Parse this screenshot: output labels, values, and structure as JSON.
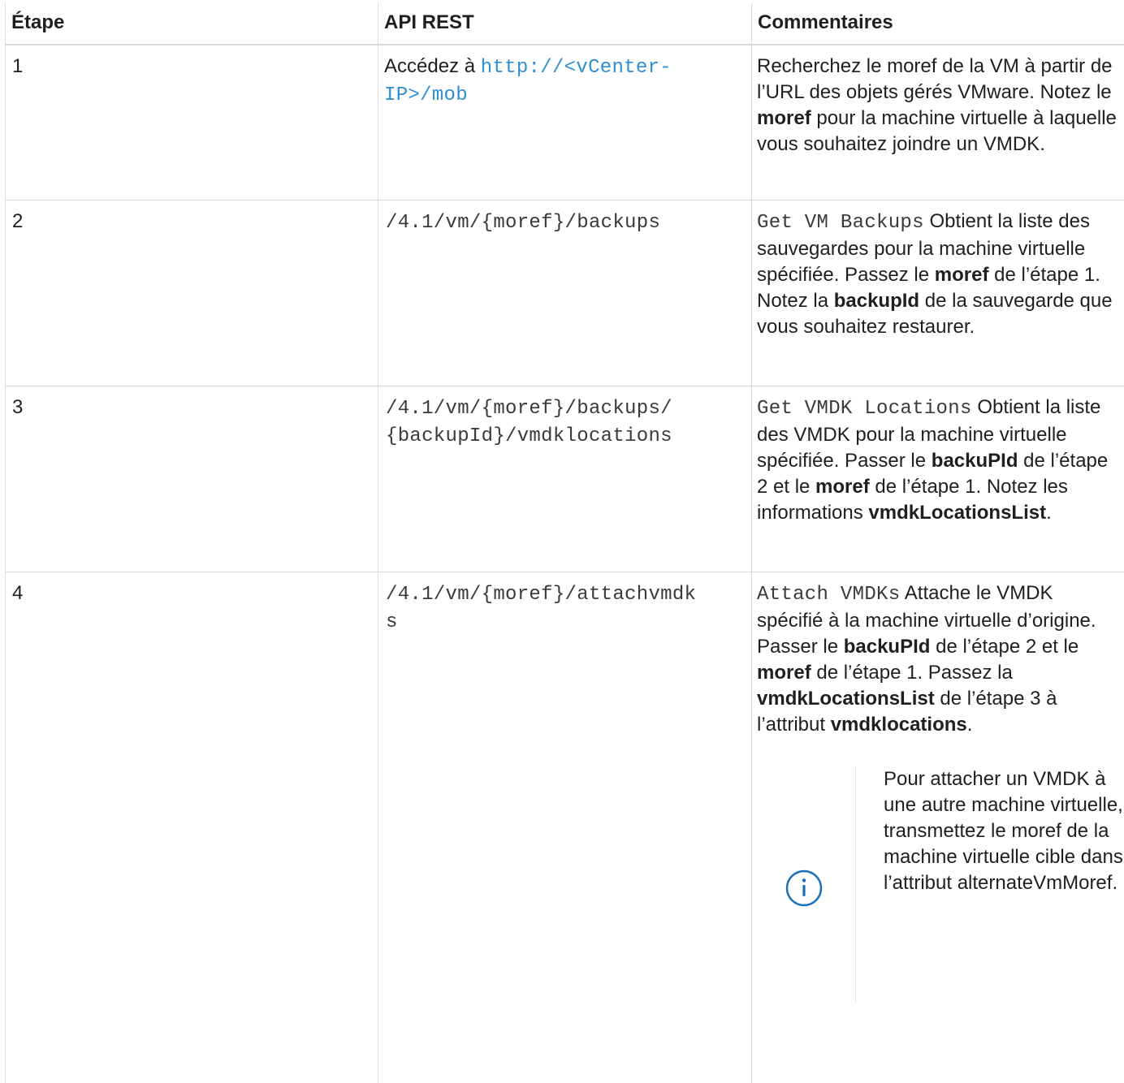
{
  "headers": {
    "step": "Étape",
    "api": "API REST",
    "comments": "Commentaires"
  },
  "rows": [
    {
      "step": "1",
      "api_prefix": "Accédez à",
      "api_link": "http://<vCenter-IP>/mob",
      "comment": {
        "t1": "Recherchez le moref de la VM à partir de l’URL des objets gérés VMware. Notez le ",
        "b1": "moref",
        "t2": " pour la machine virtuelle à laquelle vous souhaitez joindre un VMDK."
      }
    },
    {
      "step": "2",
      "api": "/4.1/vm/{moref}/backups",
      "comment": {
        "code": "Get VM Backups",
        "t1": " Obtient la liste des sauvegardes pour la machine virtuelle spécifiée. Passez le ",
        "b1": "moref",
        "t2": " de l’étape 1. Notez la ",
        "b2": "backupId",
        "t3": " de la sauvegarde que vous souhaitez restaurer."
      }
    },
    {
      "step": "3",
      "api_line1": "/4.1/vm/{moref}/backups/",
      "api_line2": "{backupId}/vmdklocations",
      "comment": {
        "code": "Get VMDK Locations",
        "t1": " Obtient la liste des VMDK pour la machine virtuelle spécifiée. Passer le ",
        "b1": "backuPId",
        "t2": " de l’étape 2 et le ",
        "b2": "moref",
        "t3": " de l’étape 1. Notez les informations ",
        "b3": "vmdkLocationsList",
        "t4": "."
      }
    },
    {
      "step": "4",
      "api_line1": "/4.1/vm/{moref}/attachvmdk",
      "api_line2": "s",
      "comment": {
        "code": "Attach VMDKs",
        "t1": " Attache le VMDK spécifié à la machine virtuelle d’origine. Passer le ",
        "b1": "backuPId",
        "t2": " de l’étape 2 et le ",
        "b2": "moref",
        "t3": " de l’étape 1. Passez la ",
        "b3": "vmdkLocationsList",
        "t4": " de l’étape 3 à l’attribut ",
        "b4": "vmdklocations",
        "t5": "."
      },
      "note": "Pour attacher un VMDK à une autre machine virtuelle, transmettez le moref de la machine virtuelle cible dans l’attribut alternateVmMoref.",
      "note_icon": "info-icon"
    }
  ],
  "colors": {
    "link": "#2f8fd3",
    "info_icon": "#1a6fb5",
    "border": "#d9d9d9"
  }
}
